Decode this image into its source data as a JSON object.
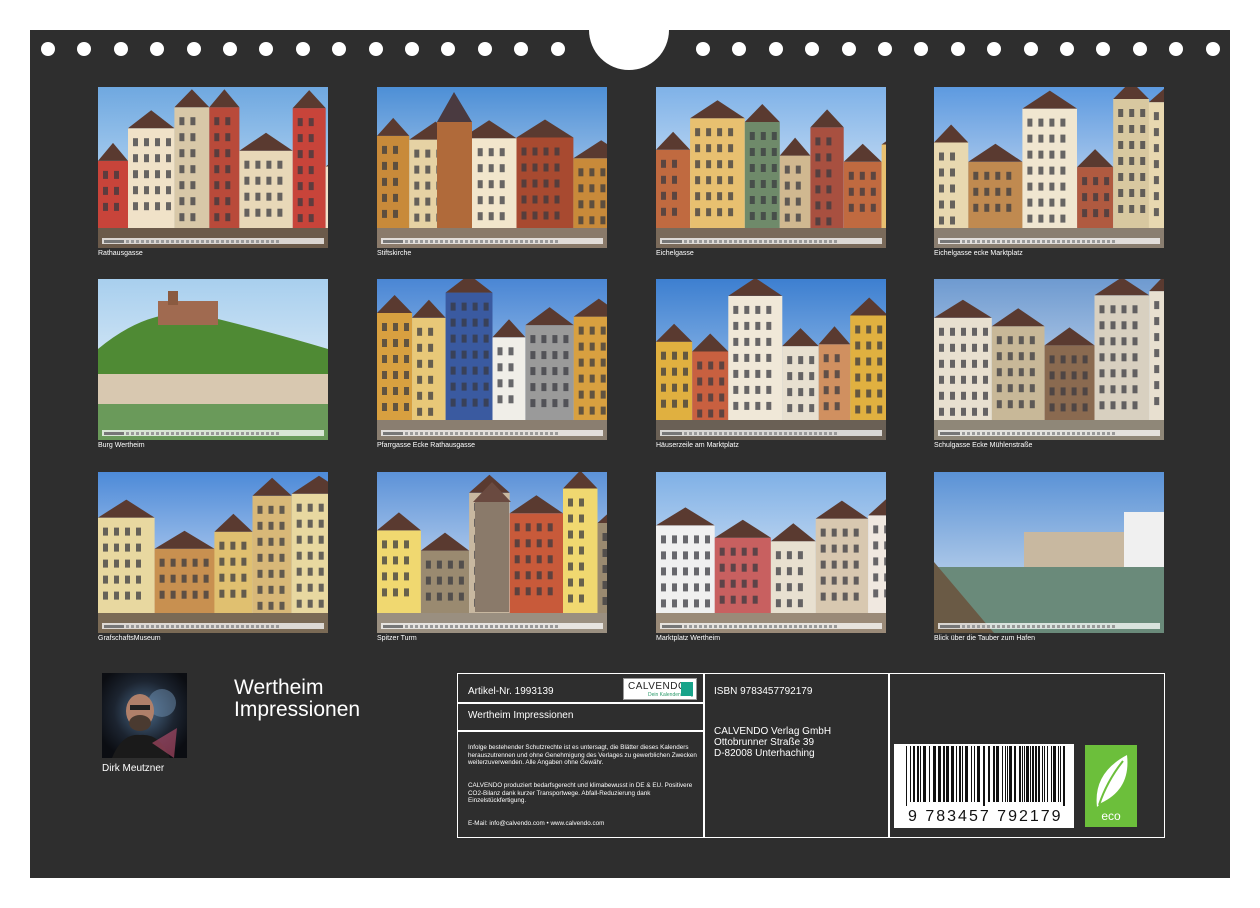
{
  "tiles": [
    {
      "caption": "Rathausgasse",
      "month": "Juli"
    },
    {
      "caption": "Stiftskirche",
      "month": "Februar"
    },
    {
      "caption": "Eichelgasse",
      "month": "März"
    },
    {
      "caption": "Eichelgasse ecke Marktplatz",
      "month": "April"
    },
    {
      "caption": "Burg Wertheim",
      "month": "Mai"
    },
    {
      "caption": "Pfarrgasse Ecke Rathausgasse",
      "month": "Juni"
    },
    {
      "caption": "Häuserzeile am Marktplatz",
      "month": "Juli"
    },
    {
      "caption": "Schulgasse Ecke Mühlenstraße",
      "month": "August"
    },
    {
      "caption": "GrafschaftsMuseum",
      "month": "September"
    },
    {
      "caption": "Spitzer Turm",
      "month": "Oktober"
    },
    {
      "caption": "Marktplatz Wertheim",
      "month": "November"
    },
    {
      "caption": "Blick über die Tauber zum Hafen",
      "month": "Dezember"
    }
  ],
  "author": "Dirk Meutzner",
  "title_line1": "Wertheim",
  "title_line2": "Impressionen",
  "info": {
    "article": "Artikel-Nr. 1993139",
    "logo_text": "CALVENDO",
    "logo_sub": "Dein Kalenderverlag",
    "product_title": "Wertheim Impressionen",
    "legal1": "Infolge bestehender Schutzrechte ist es untersagt, die Blätter dieses Kalenders herauszutrennen und ohne Genehmigung des Verlages zu gewerblichen Zwecken weiterzuverwenden. Alle Angaben ohne Gewähr.",
    "legal2": "CALVENDO produziert bedarfsgerecht und klimabewusst in DE & EU. Positivere CO2-Bilanz dank kurzer Transportwege. Abfall-Reduzierung dank Einzelstückfertigung.",
    "contact": "E-Mail: info@calvendo.com • www.calvendo.com",
    "isbn": "ISBN 9783457792179",
    "publisher": "CALVENDO Verlag GmbH",
    "street": "Ottobrunner Straße 39",
    "city": "D-82008 Unterhaching",
    "barcode_number": "9 783457 792179",
    "eco_label": "eco"
  }
}
